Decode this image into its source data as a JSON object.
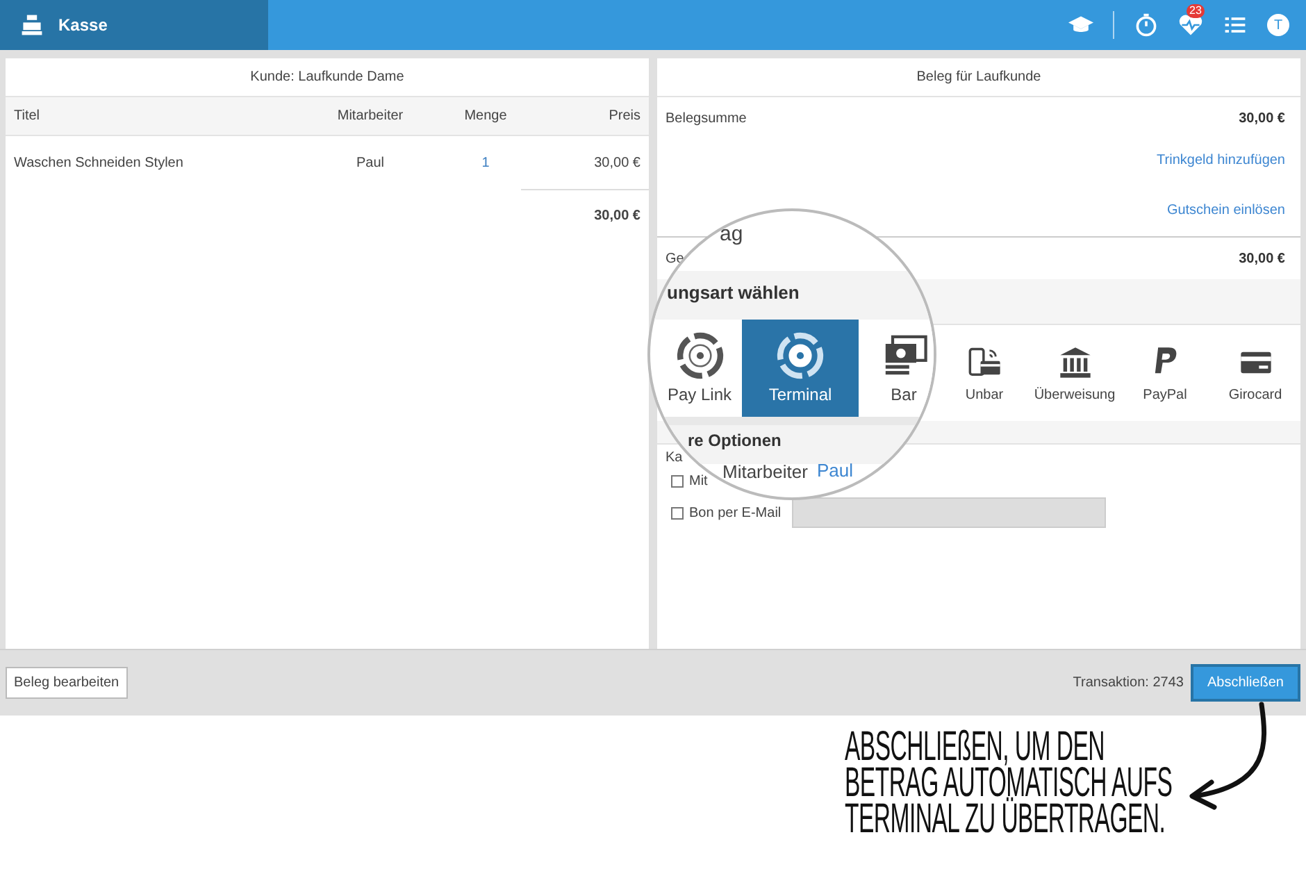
{
  "topbar": {
    "title": "Kasse",
    "badge": "23",
    "avatar": "T"
  },
  "customer_panel": {
    "title": "Kunde: Laufkunde Dame",
    "columns": [
      "Titel",
      "Mitarbeiter",
      "Menge",
      "Preis"
    ],
    "rows": [
      {
        "title": "Waschen Schneiden Stylen",
        "staff": "Paul",
        "quantity": "1",
        "price": "30,00 €"
      }
    ],
    "total": "30,00 €"
  },
  "receipt_panel": {
    "title": "Beleg für Laufkunde",
    "sum_label": "Belegsumme",
    "sum_value": "30,00 €",
    "tip_link": "Trinkgeld hinzufügen",
    "voucher_link": "Gutschein einlösen",
    "total_label": "Ge",
    "total_value": "30,00 €",
    "methods": [
      {
        "label": "Unbar",
        "kind": "cashless",
        "selected": false
      },
      {
        "label": "Überweisung",
        "kind": "bank",
        "selected": false
      },
      {
        "label": "PayPal",
        "kind": "paypal",
        "selected": false
      },
      {
        "label": "Girocard",
        "kind": "card",
        "selected": false
      }
    ],
    "options_label": "Ka",
    "options": [
      {
        "label": "Mit",
        "checked": false,
        "kind": "plain"
      },
      {
        "label": "Bon per E-Mail",
        "checked": false,
        "kind": "field"
      }
    ]
  },
  "magnifier": {
    "amount_label": "ag",
    "section_title": "ungsart wählen",
    "methods": [
      {
        "label": "Pay Link",
        "kind": "swirl",
        "selected": false
      },
      {
        "label": "Terminal",
        "kind": "swirl",
        "selected": true
      },
      {
        "label": "Bar",
        "kind": "cash",
        "selected": false
      }
    ],
    "options_title": "re Optionen",
    "option_label": "Mitarbeiter",
    "option_value": "Paul"
  },
  "footer": {
    "edit_button": "Beleg bearbeiten",
    "transaction": "Transaktion: 2743",
    "finish_button": "Abschließen"
  },
  "annotation": {
    "text": "ABSCHLIEßEN, UM DEN BETRAG AUTOMATISCH AUFS TERMINAL ZU ÜBERTRAGEN."
  }
}
